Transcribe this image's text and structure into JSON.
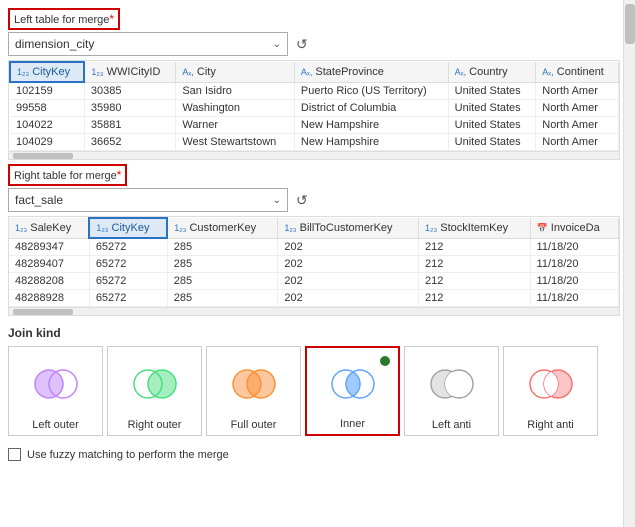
{
  "left_table": {
    "label": "Left table for merge",
    "required": "*",
    "selected": "dimension_city",
    "refresh_icon": "↺",
    "columns": [
      {
        "icon": "123",
        "name": "CityKey",
        "selected": true
      },
      {
        "icon": "123",
        "name": "WWICityID"
      },
      {
        "icon": "abc",
        "name": "City"
      },
      {
        "icon": "abc",
        "name": "StateProvince"
      },
      {
        "icon": "abc",
        "name": "Country"
      },
      {
        "icon": "abc",
        "name": "Continent"
      }
    ],
    "rows": [
      [
        "102159",
        "30385",
        "San Isidro",
        "Puerto Rico (US Territory)",
        "United States",
        "North Amer"
      ],
      [
        "99558",
        "35980",
        "Washington",
        "District of Columbia",
        "United States",
        "North Amer"
      ],
      [
        "104022",
        "35881",
        "Warner",
        "New Hampshire",
        "United States",
        "North Amer"
      ],
      [
        "104029",
        "36652",
        "West Stewartstown",
        "New Hampshire",
        "United States",
        "North Amer"
      ]
    ]
  },
  "right_table": {
    "label": "Right table for merge",
    "required": "*",
    "selected": "fact_sale",
    "refresh_icon": "↺",
    "columns": [
      {
        "icon": "123",
        "name": "SaleKey"
      },
      {
        "icon": "123",
        "name": "CityKey",
        "selected": true
      },
      {
        "icon": "123",
        "name": "CustomerKey"
      },
      {
        "icon": "123",
        "name": "BillToCustomerKey"
      },
      {
        "icon": "123",
        "name": "StockItemKey"
      },
      {
        "icon": "cal",
        "name": "InvoiceDa"
      }
    ],
    "rows": [
      [
        "48289347",
        "65272",
        "285",
        "202",
        "212",
        "11/18/20"
      ],
      [
        "48289407",
        "65272",
        "285",
        "202",
        "212",
        "11/18/20"
      ],
      [
        "48288208",
        "65272",
        "285",
        "202",
        "212",
        "11/18/20"
      ],
      [
        "48288928",
        "65272",
        "285",
        "202",
        "212",
        "11/18/20"
      ]
    ]
  },
  "join_kind": {
    "label": "Join kind",
    "options": [
      {
        "id": "left-outer",
        "label": "Left outer",
        "selected": false
      },
      {
        "id": "right-outer",
        "label": "Right outer",
        "selected": false
      },
      {
        "id": "full-outer",
        "label": "Full outer",
        "selected": false
      },
      {
        "id": "inner",
        "label": "Inner",
        "selected": true
      },
      {
        "id": "left-anti",
        "label": "Left anti",
        "selected": false
      },
      {
        "id": "right-anti",
        "label": "Right anti",
        "selected": false
      }
    ]
  },
  "fuzzy": {
    "label": "Use fuzzy matching to perform the merge"
  }
}
